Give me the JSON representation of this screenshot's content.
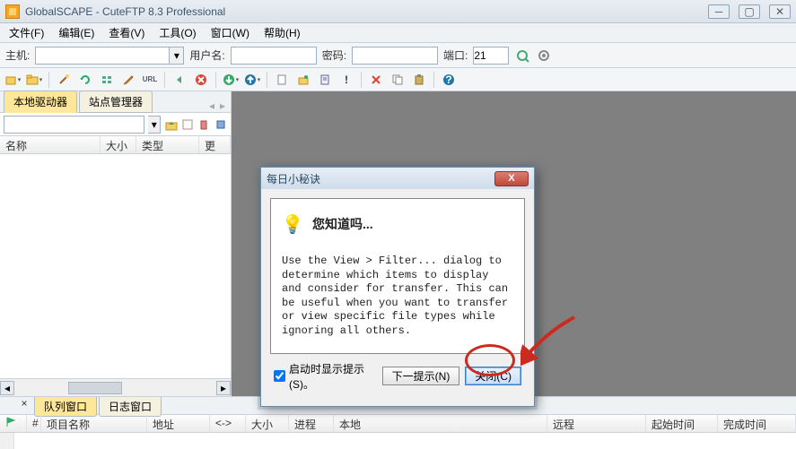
{
  "title": "GlobalSCAPE - CuteFTP 8.3 Professional",
  "menu": {
    "file": "文件(F)",
    "edit": "编辑(E)",
    "view": "查看(V)",
    "tools": "工具(O)",
    "window": "窗口(W)",
    "help": "帮助(H)"
  },
  "conn": {
    "host_label": "主机:",
    "host_value": "",
    "user_label": "用户名:",
    "user_value": "",
    "pass_label": "密码:",
    "pass_value": "",
    "port_label": "端口:",
    "port_value": "21"
  },
  "left_tabs": {
    "local": "本地驱动器",
    "site": "站点管理器"
  },
  "left_cols": {
    "name": "名称",
    "size": "大小",
    "type": "类型",
    "more": "更"
  },
  "left_path": "",
  "bottom_tabs": {
    "queue": "队列窗口",
    "log": "日志窗口"
  },
  "queue_cols": {
    "num": "#",
    "item": "项目名称",
    "addr": "地址",
    "dir": "<->",
    "size": "大小",
    "prog": "进程",
    "local": "本地",
    "remote": "远程",
    "start": "起始时间",
    "end": "完成时间"
  },
  "dialog": {
    "title": "每日小秘诀",
    "heading": "您知道吗...",
    "tip": "Use the View > Filter... dialog to determine which items to display and consider for transfer. This can be useful when you want to transfer or view specific file types while ignoring all others.",
    "checkbox": "启动时显示提示(S)。",
    "next": "下一提示(N)",
    "close": "关闭(C)"
  }
}
